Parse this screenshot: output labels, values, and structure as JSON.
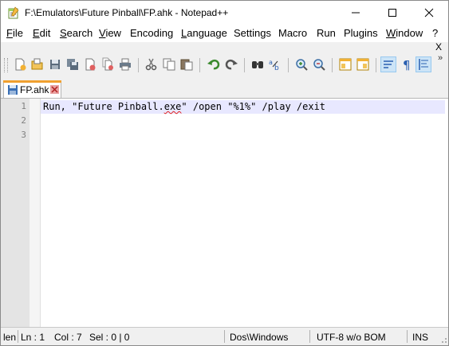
{
  "window": {
    "title": "F:\\Emulators\\Future Pinball\\FP.ahk - Notepad++",
    "doc_close_label": "X"
  },
  "menu": {
    "items": [
      {
        "label_u": "F",
        "label_rest": "ile"
      },
      {
        "label_u": "E",
        "label_rest": "dit"
      },
      {
        "label_u": "S",
        "label_rest": "earch"
      },
      {
        "label_u": "V",
        "label_rest": "iew"
      },
      {
        "label_u": "",
        "label_rest": "Encoding"
      },
      {
        "label_u": "L",
        "label_rest": "anguage"
      },
      {
        "label_u": "",
        "label_rest": "Settings"
      },
      {
        "label_u": "",
        "label_rest": "Macro"
      },
      {
        "label_u": "",
        "label_rest": "Run"
      },
      {
        "label_u": "",
        "label_rest": "Plugins"
      },
      {
        "label_u": "W",
        "label_rest": "indow"
      },
      {
        "label_u": "",
        "label_rest": "?"
      }
    ]
  },
  "toolbar": {
    "overflow_label": "»",
    "icons": [
      "new-file-icon",
      "open-file-icon",
      "save-icon",
      "save-all-icon",
      "close-icon",
      "close-all-icon",
      "print-icon",
      "cut-icon",
      "copy-icon",
      "paste-icon",
      "undo-icon",
      "redo-icon",
      "find-icon",
      "replace-icon",
      "zoom-in-icon",
      "zoom-out-icon",
      "sync-vertical-icon",
      "sync-horizontal-icon",
      "word-wrap-icon",
      "show-all-chars-icon",
      "indent-guide-icon"
    ]
  },
  "tabs": [
    {
      "label": "FP.ahk"
    }
  ],
  "editor": {
    "line_numbers": [
      "1",
      "2",
      "3"
    ],
    "line1_before": "Run, \"Future Pinball.",
    "line1_spell": "exe",
    "line1_after": "\" /open \"%1%\" /play /exit",
    "line2": "",
    "line3": ""
  },
  "status": {
    "length": "len",
    "ln": "Ln : 1",
    "col": "Col : 7",
    "sel": "Sel : 0 | 0",
    "eol": "Dos\\Windows",
    "encoding": "UTF-8 w/o BOM",
    "mode": "INS"
  },
  "colors": {
    "current_line": "#e8e8ff",
    "tab_accent": "#f0a030",
    "gutter": "#e4e4e4"
  }
}
